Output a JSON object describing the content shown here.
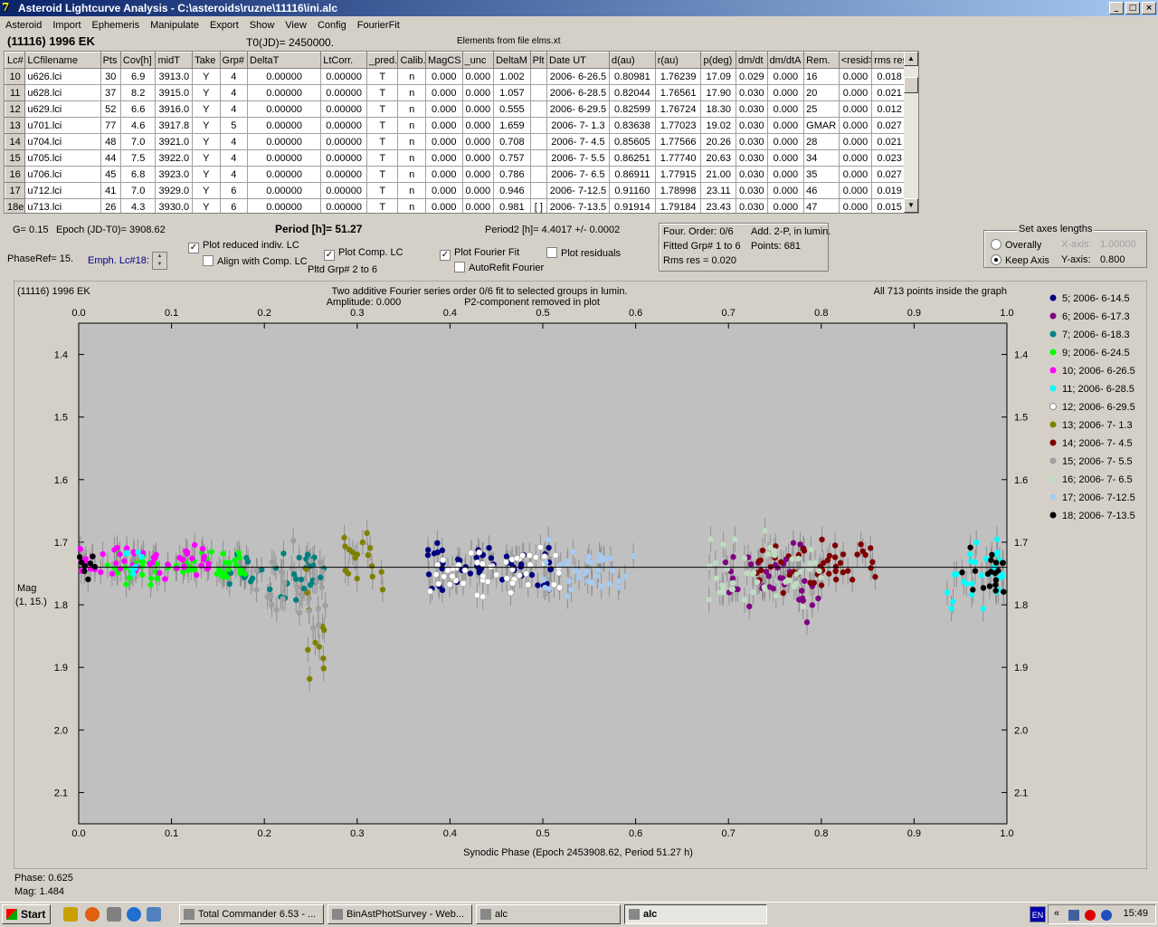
{
  "window": {
    "title": "Asteroid Lightcurve Analysis - C:\\asteroids\\ruzne\\11116\\ini.alc"
  },
  "menu": [
    "Asteroid",
    "Import",
    "Ephemeris",
    "Manipulate",
    "Export",
    "Show",
    "View",
    "Config",
    "FourierFit"
  ],
  "header": {
    "asteroid": "(11116) 1996 EK",
    "t0": "T0(JD)= 2450000.",
    "elements": "Elements from file elms.xt"
  },
  "table": {
    "columns": [
      "Lc#",
      "LCfilename",
      "Pts",
      "Cov[h]",
      "midT",
      "Take",
      "Grp#",
      "DeltaT",
      "LtCorr.",
      "_pred.",
      "Calib.",
      "MagCS",
      "_unc",
      "DeltaM",
      "Plt",
      "Date UT",
      "d(au)",
      "r(au)",
      "p(deg)",
      "dm/dt",
      "dm/dtA",
      "Rem.",
      "<resid>",
      "rms res"
    ],
    "rows": [
      [
        "10",
        "u626.lci",
        "30",
        "6.9",
        "3913.0",
        "Y",
        "4",
        "0.00000",
        "0.00000",
        "T",
        "n",
        "0.000",
        "0.000",
        "1.002",
        "",
        "2006- 6-26.5",
        "0.80981",
        "1.76239",
        "17.09",
        "0.029",
        "0.000",
        "16",
        "0.000",
        "0.018"
      ],
      [
        "11",
        "u628.lci",
        "37",
        "8.2",
        "3915.0",
        "Y",
        "4",
        "0.00000",
        "0.00000",
        "T",
        "n",
        "0.000",
        "0.000",
        "1.057",
        "",
        "2006- 6-28.5",
        "0.82044",
        "1.76561",
        "17.90",
        "0.030",
        "0.000",
        "20",
        "0.000",
        "0.021"
      ],
      [
        "12",
        "u629.lci",
        "52",
        "6.6",
        "3916.0",
        "Y",
        "4",
        "0.00000",
        "0.00000",
        "T",
        "n",
        "0.000",
        "0.000",
        "0.555",
        "",
        "2006- 6-29.5",
        "0.82599",
        "1.76724",
        "18.30",
        "0.030",
        "0.000",
        "25",
        "0.000",
        "0.012"
      ],
      [
        "13",
        "u701.lci",
        "77",
        "4.6",
        "3917.8",
        "Y",
        "5",
        "0.00000",
        "0.00000",
        "T",
        "n",
        "0.000",
        "0.000",
        "1.659",
        "",
        "2006- 7- 1.3",
        "0.83638",
        "1.77023",
        "19.02",
        "0.030",
        "0.000",
        "GMAR",
        "0.000",
        "0.027"
      ],
      [
        "14",
        "u704.lci",
        "48",
        "7.0",
        "3921.0",
        "Y",
        "4",
        "0.00000",
        "0.00000",
        "T",
        "n",
        "0.000",
        "0.000",
        "0.708",
        "",
        "2006- 7- 4.5",
        "0.85605",
        "1.77566",
        "20.26",
        "0.030",
        "0.000",
        "28",
        "0.000",
        "0.021"
      ],
      [
        "15",
        "u705.lci",
        "44",
        "7.5",
        "3922.0",
        "Y",
        "4",
        "0.00000",
        "0.00000",
        "T",
        "n",
        "0.000",
        "0.000",
        "0.757",
        "",
        "2006- 7- 5.5",
        "0.86251",
        "1.77740",
        "20.63",
        "0.030",
        "0.000",
        "34",
        "0.000",
        "0.023"
      ],
      [
        "16",
        "u706.lci",
        "45",
        "6.8",
        "3923.0",
        "Y",
        "4",
        "0.00000",
        "0.00000",
        "T",
        "n",
        "0.000",
        "0.000",
        "0.786",
        "",
        "2006- 7- 6.5",
        "0.86911",
        "1.77915",
        "21.00",
        "0.030",
        "0.000",
        "35",
        "0.000",
        "0.027"
      ],
      [
        "17",
        "u712.lci",
        "41",
        "7.0",
        "3929.0",
        "Y",
        "6",
        "0.00000",
        "0.00000",
        "T",
        "n",
        "0.000",
        "0.000",
        "0.946",
        "",
        "2006- 7-12.5",
        "0.91160",
        "1.78998",
        "23.11",
        "0.030",
        "0.000",
        "46",
        "0.000",
        "0.019"
      ],
      [
        "18e",
        "u713.lci",
        "26",
        "4.3",
        "3930.0",
        "Y",
        "6",
        "0.00000",
        "0.00000",
        "T",
        "n",
        "0.000",
        "0.000",
        "0.981",
        "[ ]",
        "2006- 7-13.5",
        "0.91914",
        "1.79184",
        "23.43",
        "0.030",
        "0.000",
        "47",
        "0.000",
        "0.015"
      ]
    ]
  },
  "controls": {
    "g": "G= 0.15",
    "epoch": "Epoch (JD-T0)= 3908.62",
    "period": "Period [h]= 51.27",
    "period2": "Period2 [h]= 4.4017 +/- 0.0002",
    "phaseref": "PhaseRef= 15.",
    "emph": "Emph. Lc#18:",
    "plot_reduced": "Plot reduced indiv. LC",
    "align_comp": "Align with Comp. LC",
    "plot_comp": "Plot Comp. LC",
    "pltd_grp": "Pltd Grp#  2  to   6",
    "plot_fourier": "Plot Fourier Fit",
    "plot_residuals": "Plot residuals",
    "autorefit": "AutoRefit Fourier",
    "four_order": "Four. Order:  0/6",
    "add2p": "Add. 2-P,  in lumin.",
    "fitted": "Fitted Grp# 1 to 6",
    "points": "Points: 681",
    "rms": "Rms res      = 0.020",
    "set_axes": "Set axes lengths",
    "overally": "Overally",
    "keep_axis": "Keep Axis",
    "xaxis": "X-axis:",
    "xaxis_val": "1.00000",
    "yaxis": "Y-axis:",
    "yaxis_val": "0.800"
  },
  "status": {
    "phase": "Phase:  0.625",
    "mag": "Mag:    1.484"
  },
  "taskbar": {
    "start": "Start",
    "tasks": [
      "Total Commander 6.53 - ...",
      "BinAstPhotSurvey - Web...",
      "alc",
      "alc"
    ],
    "lang": "EN",
    "clock": "15:49"
  },
  "chart_data": {
    "type": "scatter",
    "title_left": "(11116) 1996 EK",
    "title_center_1": "Two additive Fourier series order 0/6 fit to selected groups in lumin.",
    "title_center_2": "Amplitude: 0.000",
    "title_center_3": "P2-component removed in plot",
    "title_right": "All 713 points inside the graph",
    "xlabel": "Synodic Phase (Epoch 2453908.62, Period 51.27 h)",
    "ylabel_1": "Mag",
    "ylabel_2": "(1, 15.)",
    "xlim": [
      0.0,
      1.0
    ],
    "ylim": [
      1.35,
      2.15
    ],
    "y_inverted": true,
    "x_ticks": [
      "0.0",
      "0.1",
      "0.2",
      "0.3",
      "0.4",
      "0.5",
      "0.6",
      "0.7",
      "0.8",
      "0.9",
      "1.0"
    ],
    "y_ticks": [
      "1.4",
      "1.5",
      "1.6",
      "1.7",
      "1.8",
      "1.9",
      "2.0",
      "2.1"
    ],
    "fit_line_mag": 1.74,
    "grid": false,
    "legend_position": "right",
    "series": [
      {
        "name": "5; 2006- 6-14.5",
        "color": "#000080",
        "ranges": [
          [
            0.375,
            0.51,
            1.74,
            0.018
          ]
        ]
      },
      {
        "name": "6; 2006- 6-17.3",
        "color": "#800080",
        "ranges": [
          [
            0.695,
            0.8,
            1.76,
            0.03
          ]
        ]
      },
      {
        "name": "7; 2006- 6-18.3",
        "color": "#008080",
        "ranges": [
          [
            0.16,
            0.265,
            1.75,
            0.02
          ]
        ]
      },
      {
        "name": "9; 2006- 6-24.5",
        "color": "#00ff00",
        "ranges": [
          [
            0.03,
            0.18,
            1.74,
            0.012
          ]
        ]
      },
      {
        "name": "10; 2006- 6-26.5",
        "color": "#ff00ff",
        "ranges": [
          [
            0.0,
            0.14,
            1.73,
            0.012
          ]
        ]
      },
      {
        "name": "11; 2006- 6-28.5",
        "color": "#00ffff",
        "ranges": [
          [
            0.05,
            0.07,
            1.74,
            0.015
          ],
          [
            0.93,
            1.0,
            1.75,
            0.025
          ]
        ]
      },
      {
        "name": "12; 2006- 6-29.5",
        "color": "#ffffff",
        "ranges": [
          [
            0.375,
            0.52,
            1.74,
            0.02
          ]
        ]
      },
      {
        "name": "13; 2006- 7- 1.3",
        "color": "#808000",
        "ranges": [
          [
            0.24,
            0.27,
            1.82,
            0.04
          ],
          [
            0.285,
            0.33,
            1.73,
            0.025
          ]
        ]
      },
      {
        "name": "14; 2006- 7- 4.5",
        "color": "#800000",
        "ranges": [
          [
            0.73,
            0.86,
            1.74,
            0.02
          ]
        ]
      },
      {
        "name": "15; 2006- 7- 5.5",
        "color": "#a0a0a0",
        "ranges": [
          [
            0.19,
            0.27,
            1.77,
            0.04
          ]
        ]
      },
      {
        "name": "16; 2006- 7- 6.5",
        "color": "#c0dcc0",
        "ranges": [
          [
            0.675,
            0.8,
            1.75,
            0.03
          ]
        ]
      },
      {
        "name": "17; 2006- 7-12.5",
        "color": "#a6caf0",
        "ranges": [
          [
            0.5,
            0.6,
            1.74,
            0.02
          ]
        ]
      },
      {
        "name": "18; 2006- 7-13.5",
        "color": "#000000",
        "ranges": [
          [
            0.0,
            0.02,
            1.74,
            0.012
          ],
          [
            0.95,
            1.0,
            1.75,
            0.02
          ]
        ]
      }
    ]
  }
}
